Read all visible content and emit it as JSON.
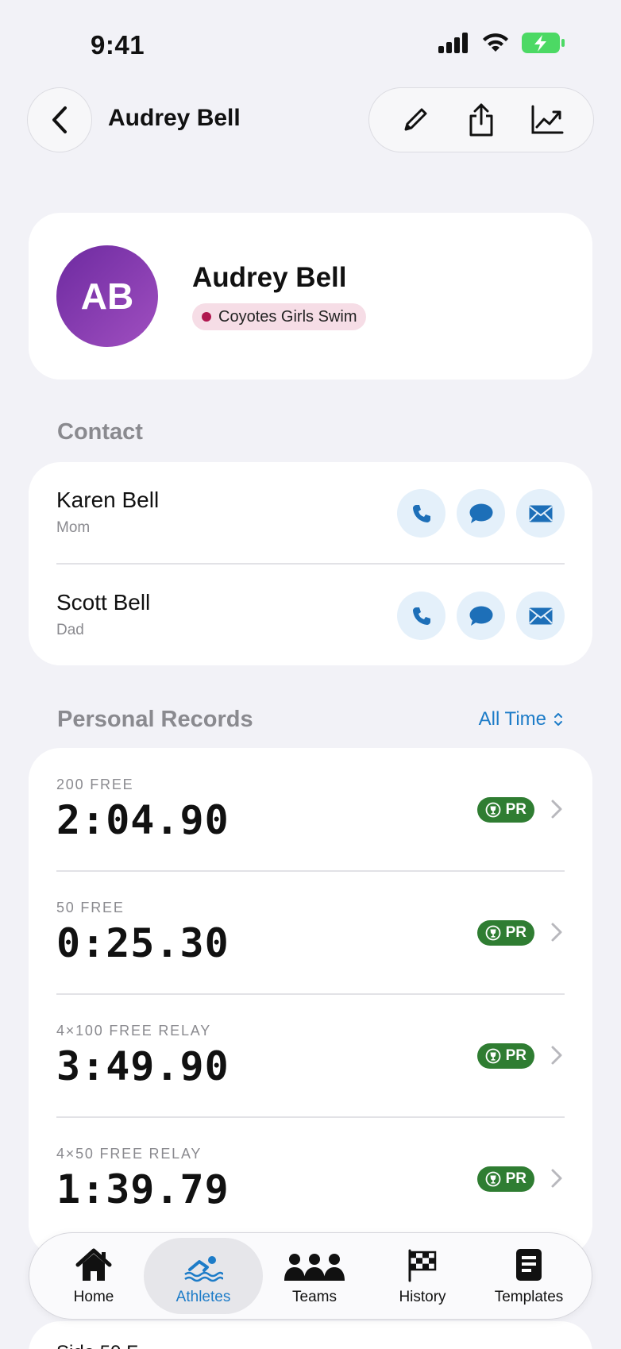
{
  "status": {
    "time": "9:41"
  },
  "nav": {
    "title": "Audrey Bell"
  },
  "profile": {
    "initials": "AB",
    "name": "Audrey Bell",
    "team": "Coyotes Girls Swim"
  },
  "contact": {
    "title": "Contact",
    "items": [
      {
        "name": "Karen Bell",
        "relation": "Mom"
      },
      {
        "name": "Scott Bell",
        "relation": "Dad"
      }
    ]
  },
  "records": {
    "title": "Personal Records",
    "filter": "All Time",
    "items": [
      {
        "event": "200 FREE",
        "time": "2:04.90",
        "badge": "PR"
      },
      {
        "event": "50 FREE",
        "time": "0:25.30",
        "badge": "PR"
      },
      {
        "event": "4×100 FREE RELAY",
        "time": "3:49.90",
        "badge": "PR"
      },
      {
        "event": "4×50 FREE RELAY",
        "time": "1:39.79",
        "badge": "PR"
      }
    ]
  },
  "tabs": [
    {
      "label": "Home",
      "icon": "house-icon"
    },
    {
      "label": "Athletes",
      "icon": "swimmer-icon",
      "active": true
    },
    {
      "label": "Teams",
      "icon": "people-icon"
    },
    {
      "label": "History",
      "icon": "checkered-flag-icon"
    },
    {
      "label": "Templates",
      "icon": "document-icon"
    }
  ],
  "peek": {
    "text": "Side 50 F..."
  },
  "colors": {
    "accent": "#1d7cc8",
    "pr_badge": "#2f7d32",
    "avatar": "#8a3cb3",
    "team_dot": "#b0174f"
  }
}
